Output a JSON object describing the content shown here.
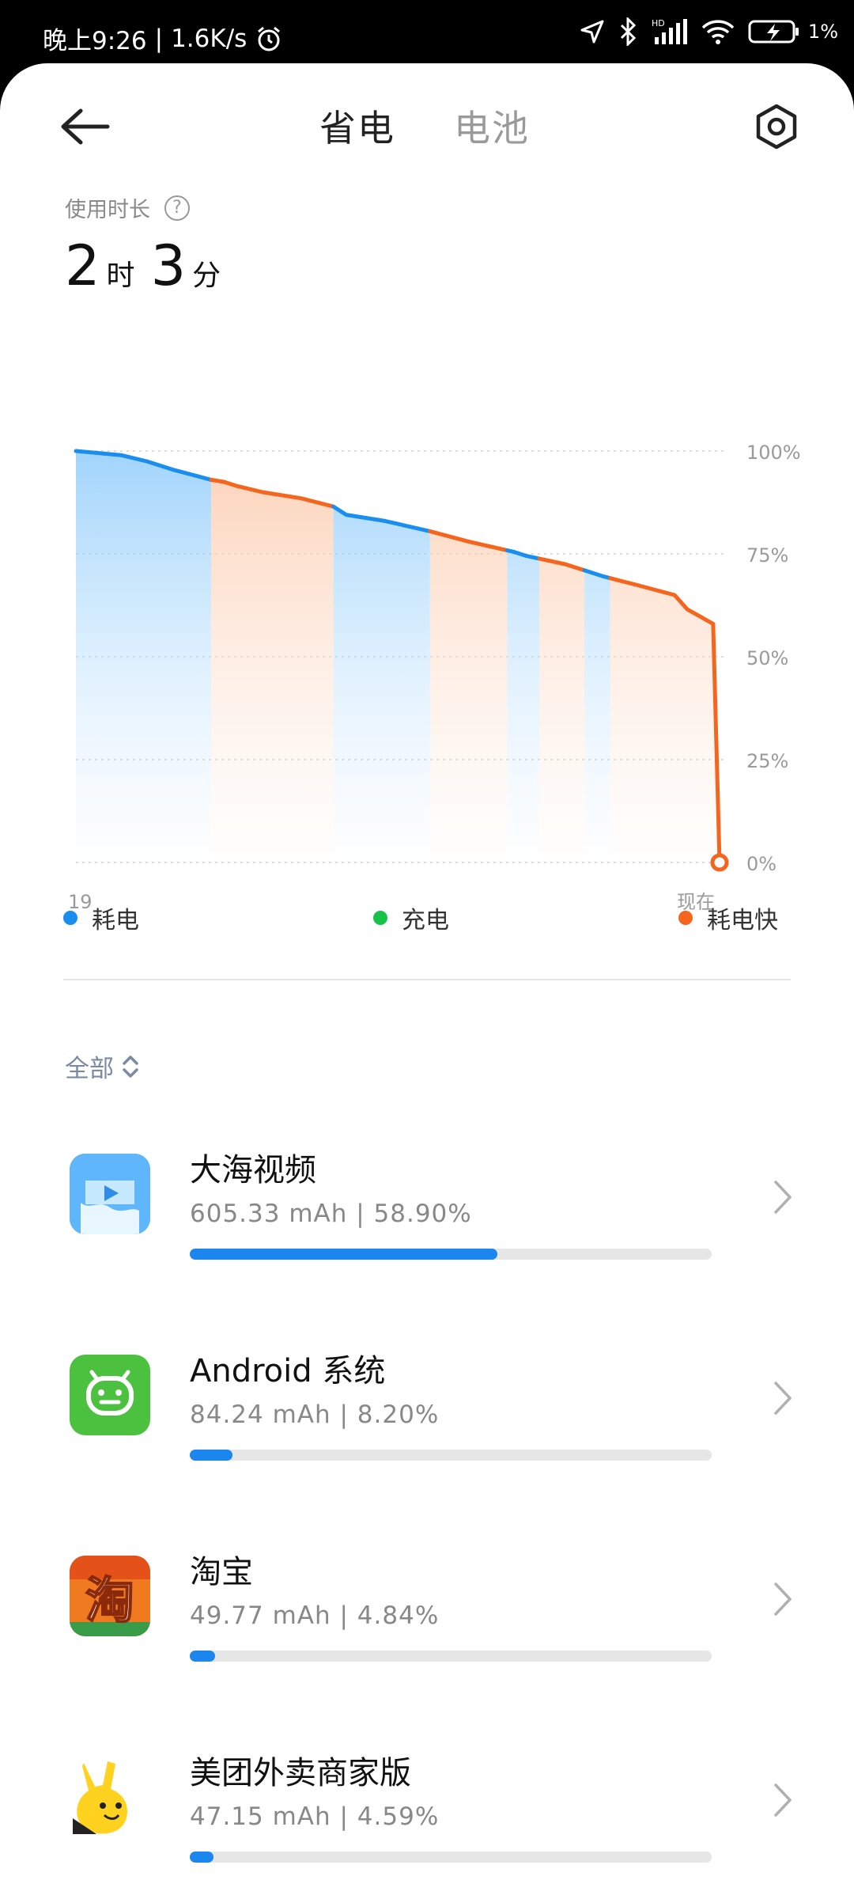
{
  "status_bar": {
    "time": "晚上9:26",
    "net_speed": "1.6K/s",
    "battery_pct": "1%"
  },
  "header": {
    "tabs": [
      "省电",
      "电池"
    ],
    "active_tab": 0
  },
  "usage": {
    "label": "使用时长",
    "hours": "2",
    "hours_unit": "时",
    "minutes": "3",
    "minutes_unit": "分"
  },
  "chart_data": {
    "type": "area",
    "y_ticks": [
      "100%",
      "75%",
      "50%",
      "25%",
      "0%"
    ],
    "x_labels": [
      "19",
      "现在"
    ],
    "ylim": [
      0,
      100
    ],
    "series": [
      {
        "name": "耗电",
        "color": "#1a8eef"
      },
      {
        "name": "耗电快",
        "color": "#f5651e"
      }
    ],
    "points": [
      [
        0,
        100
      ],
      [
        0.07,
        99
      ],
      [
        0.11,
        97.5
      ],
      [
        0.15,
        95.5
      ],
      [
        0.21,
        93
      ],
      [
        0.23,
        92.5
      ],
      [
        0.25,
        91.5
      ],
      [
        0.29,
        90
      ],
      [
        0.35,
        88.5
      ],
      [
        0.4,
        86.5
      ],
      [
        0.42,
        84.5
      ],
      [
        0.48,
        83
      ],
      [
        0.55,
        80.5
      ],
      [
        0.61,
        78
      ],
      [
        0.68,
        75.5
      ],
      [
        0.7,
        74.5
      ],
      [
        0.76,
        72.5
      ],
      [
        0.8,
        70.5
      ],
      [
        0.82,
        69.5
      ],
      [
        0.87,
        67.5
      ],
      [
        0.93,
        65
      ],
      [
        0.95,
        61.5
      ],
      [
        0.99,
        58
      ],
      [
        1.0,
        0
      ]
    ],
    "segments": [
      {
        "from": 0.0,
        "to": 0.21,
        "kind": "耗电"
      },
      {
        "from": 0.21,
        "to": 0.4,
        "kind": "耗电快"
      },
      {
        "from": 0.4,
        "to": 0.55,
        "kind": "耗电"
      },
      {
        "from": 0.55,
        "to": 0.67,
        "kind": "耗电快"
      },
      {
        "from": 0.67,
        "to": 0.72,
        "kind": "耗电"
      },
      {
        "from": 0.72,
        "to": 0.79,
        "kind": "耗电快"
      },
      {
        "from": 0.79,
        "to": 0.83,
        "kind": "耗电"
      },
      {
        "from": 0.83,
        "to": 1.0,
        "kind": "耗电快"
      }
    ]
  },
  "legend": [
    {
      "label": "耗电",
      "color": "#1a8eef"
    },
    {
      "label": "充电",
      "color": "#18c14a"
    },
    {
      "label": "耗电快",
      "color": "#f5651e"
    }
  ],
  "filter": {
    "label": "全部"
  },
  "apps": [
    {
      "name": "大海视频",
      "stats": "605.33 mAh | 58.90%",
      "pct": 58.9,
      "icon": "video-app-icon"
    },
    {
      "name": "Android 系统",
      "stats": "84.24 mAh | 8.20%",
      "pct": 8.2,
      "icon": "android-icon"
    },
    {
      "name": "淘宝",
      "stats": "49.77 mAh | 4.84%",
      "pct": 4.84,
      "icon": "taobao-icon"
    },
    {
      "name": "美团外卖商家版",
      "stats": "47.15 mAh | 4.59%",
      "pct": 4.59,
      "icon": "meituan-merchant-icon"
    }
  ]
}
